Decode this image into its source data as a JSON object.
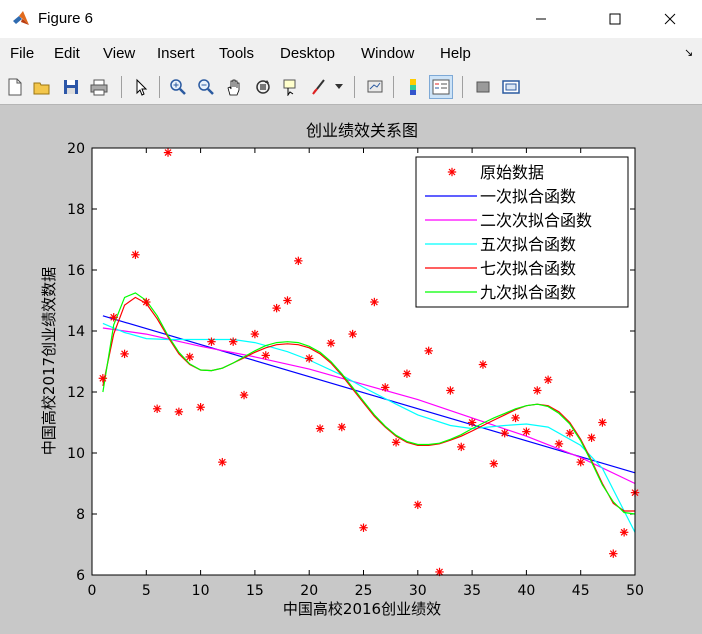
{
  "window": {
    "title": "Figure 6"
  },
  "menu": [
    "File",
    "Edit",
    "View",
    "Insert",
    "Tools",
    "Desktop",
    "Window",
    "Help"
  ],
  "toolbar_icons": [
    "new-figure-icon",
    "open-file-icon",
    "save-icon",
    "print-icon",
    "select-arrow-icon",
    "zoom-in-icon",
    "zoom-out-icon",
    "pan-hand-icon",
    "rotate-3d-icon",
    "data-cursor-icon",
    "brush-icon",
    "brush-menu-icon",
    "link-plot-icon",
    "colorbar-icon",
    "legend-icon",
    "hide-plot-tools-icon",
    "show-plot-tools-icon"
  ],
  "chart_data": {
    "type": "scatter",
    "title": "创业绩效关系图",
    "xlabel": "中国高校2016创业绩效",
    "ylabel": "中国高校2017创业绩效数据",
    "xlim": [
      0,
      50
    ],
    "ylim": [
      6,
      20
    ],
    "xticks": [
      0,
      5,
      10,
      15,
      20,
      25,
      30,
      35,
      40,
      45,
      50
    ],
    "yticks": [
      6,
      8,
      10,
      12,
      14,
      16,
      18,
      20
    ],
    "legend_position": "top-right",
    "scatter": {
      "name": "原始数据",
      "color": "#ff0000",
      "x": [
        1,
        2,
        3,
        4,
        5,
        6,
        7,
        8,
        9,
        10,
        11,
        12,
        13,
        14,
        15,
        16,
        17,
        18,
        19,
        20,
        21,
        22,
        23,
        24,
        25,
        26,
        27,
        28,
        29,
        30,
        31,
        32,
        33,
        34,
        35,
        36,
        37,
        38,
        39,
        40,
        41,
        42,
        43,
        44,
        45,
        46,
        47,
        48,
        49,
        50
      ],
      "y": [
        12.45,
        14.45,
        13.25,
        16.5,
        14.95,
        11.45,
        19.85,
        11.35,
        13.15,
        11.5,
        13.65,
        9.7,
        13.65,
        11.9,
        13.9,
        13.2,
        14.75,
        15.0,
        16.3,
        13.1,
        10.8,
        13.6,
        10.85,
        13.9,
        7.55,
        14.95,
        12.15,
        10.35,
        12.6,
        8.3,
        13.35,
        6.1,
        12.05,
        10.2,
        11.0,
        12.9,
        9.65,
        10.65,
        11.15,
        10.7,
        12.05,
        12.4,
        10.3,
        10.65,
        9.7,
        10.5,
        11.0,
        6.7,
        7.4,
        8.7
      ]
    },
    "series": [
      {
        "name": "一次拟合函数",
        "color": "#0000ff",
        "x": [
          1,
          50
        ],
        "y": [
          14.5,
          9.35
        ]
      },
      {
        "name": "二次次拟合函数",
        "color": "#ff00ff",
        "x": [
          1,
          5,
          10,
          15,
          20,
          25,
          30,
          35,
          40,
          45,
          50
        ],
        "y": [
          14.1,
          13.9,
          13.5,
          13.15,
          12.75,
          12.25,
          11.75,
          11.15,
          10.55,
          9.85,
          9.0
        ]
      },
      {
        "name": "五次拟合函数",
        "color": "#00ffff",
        "x": [
          1,
          3,
          5,
          7,
          10,
          13,
          15,
          18,
          20,
          23,
          25,
          28,
          30,
          33,
          35,
          38,
          40,
          42,
          45,
          47,
          50
        ],
        "y": [
          14.25,
          13.95,
          13.75,
          13.72,
          13.72,
          13.72,
          13.62,
          13.32,
          13.05,
          12.55,
          12.15,
          11.6,
          11.25,
          10.9,
          10.8,
          10.9,
          10.95,
          10.85,
          10.25,
          9.5,
          7.4
        ]
      },
      {
        "name": "七次拟合函数",
        "color": "#ff0000",
        "x": [
          1,
          2,
          3,
          4,
          5,
          6,
          7,
          8,
          9,
          10,
          11,
          12,
          13,
          14,
          15,
          16,
          17,
          18,
          19,
          20,
          21,
          22,
          23,
          24,
          25,
          26,
          27,
          28,
          29,
          30,
          31,
          32,
          33,
          34,
          35,
          36,
          37,
          38,
          39,
          40,
          41,
          42,
          43,
          44,
          45,
          46,
          47,
          48,
          49,
          50
        ],
        "y": [
          12.2,
          13.9,
          14.85,
          15.1,
          14.9,
          14.4,
          13.8,
          13.25,
          12.9,
          12.72,
          12.7,
          12.78,
          12.95,
          13.12,
          13.3,
          13.45,
          13.55,
          13.58,
          13.55,
          13.45,
          13.25,
          12.95,
          12.55,
          12.1,
          11.65,
          11.2,
          10.85,
          10.55,
          10.35,
          10.25,
          10.25,
          10.3,
          10.42,
          10.55,
          10.72,
          10.9,
          11.08,
          11.25,
          11.42,
          11.55,
          11.6,
          11.55,
          11.35,
          11.0,
          10.45,
          9.75,
          9.0,
          8.35,
          8.1,
          8.1
        ]
      },
      {
        "name": "九次拟合函数",
        "color": "#00ff00",
        "x": [
          1,
          2,
          3,
          4,
          5,
          6,
          7,
          8,
          9,
          10,
          11,
          12,
          13,
          14,
          15,
          16,
          17,
          18,
          19,
          20,
          21,
          22,
          23,
          24,
          25,
          26,
          27,
          28,
          29,
          30,
          31,
          32,
          33,
          34,
          35,
          36,
          37,
          38,
          39,
          40,
          41,
          42,
          43,
          44,
          45,
          46,
          47,
          48,
          49,
          50
        ],
        "y": [
          12.0,
          14.2,
          15.1,
          15.25,
          15.0,
          14.5,
          13.85,
          13.3,
          12.92,
          12.72,
          12.7,
          12.78,
          12.95,
          13.15,
          13.35,
          13.52,
          13.62,
          13.65,
          13.62,
          13.5,
          13.3,
          13.0,
          12.6,
          12.15,
          11.7,
          11.25,
          10.88,
          10.58,
          10.38,
          10.28,
          10.28,
          10.32,
          10.45,
          10.6,
          10.8,
          10.98,
          11.15,
          11.3,
          11.45,
          11.55,
          11.6,
          11.52,
          11.3,
          10.95,
          10.4,
          9.7,
          8.95,
          8.4,
          8.05,
          8.0
        ]
      }
    ]
  }
}
